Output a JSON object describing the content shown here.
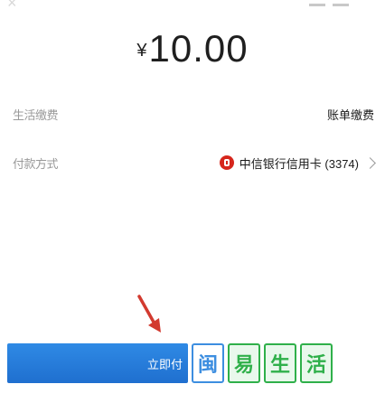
{
  "header": {
    "currency": "¥",
    "amount": "10.00"
  },
  "rows": [
    {
      "label": "生活缴费",
      "value": "账单缴费"
    },
    {
      "label": "付款方式",
      "value": "中信银行信用卡 (3374)"
    }
  ],
  "bottom": {
    "button_label": "立即付",
    "stamps": [
      "闽",
      "易",
      "生",
      "活"
    ]
  },
  "colors": {
    "accent_blue": "#2f8ae5",
    "bank_red": "#d6261c",
    "arrow_red": "#d23a2f",
    "stamp_green": "#2fb04a"
  }
}
